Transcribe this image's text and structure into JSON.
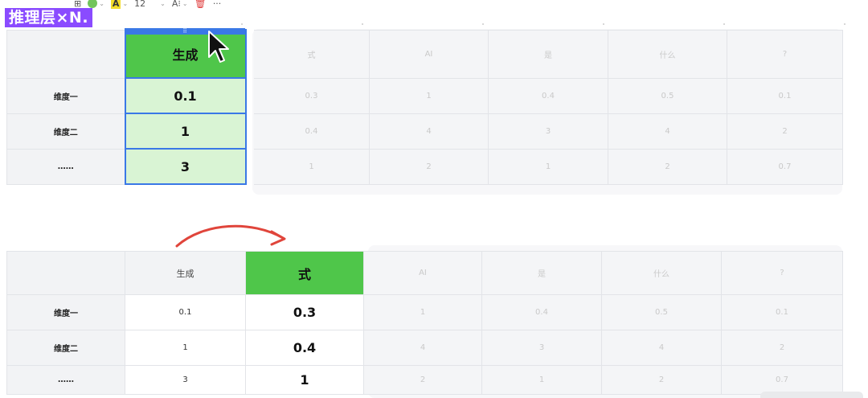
{
  "toolbar": {
    "layout_icon": "⊞",
    "font_size": "12",
    "text_style": "A⁝",
    "more": "···",
    "highlight_label": "A"
  },
  "title": "推理层×N.",
  "top_table": {
    "active_header": "生成",
    "faded_headers": [
      "式",
      "AI",
      "是",
      "什么",
      "?"
    ],
    "rows": [
      {
        "label": "维度一",
        "active": "0.1",
        "faded": [
          "0.3",
          "1",
          "0.4",
          "0.5",
          "0.1"
        ]
      },
      {
        "label": "维度二",
        "active": "1",
        "faded": [
          "0.4",
          "4",
          "3",
          "4",
          "2"
        ]
      },
      {
        "label": "……",
        "active": "3",
        "faded": [
          "1",
          "2",
          "1",
          "2",
          "0.7"
        ]
      }
    ]
  },
  "bottom_table": {
    "plain_header": "生成",
    "highlight_header": "式",
    "faded_headers": [
      "AI",
      "是",
      "什么",
      "?"
    ],
    "rows": [
      {
        "label": "维度一",
        "plain": "0.1",
        "highlight": "0.3",
        "faded": [
          "1",
          "0.4",
          "0.5",
          "0.1"
        ]
      },
      {
        "label": "维度二",
        "plain": "1",
        "highlight": "0.4",
        "faded": [
          "4",
          "3",
          "4",
          "2"
        ]
      },
      {
        "label": "……",
        "plain": "3",
        "highlight": "1",
        "faded": [
          "2",
          "1",
          "2",
          "0.7"
        ]
      }
    ]
  },
  "colors": {
    "active_green": "#4fc64a",
    "active_fill": "#d9f4d4",
    "selection_blue": "#3a78e6",
    "title_purple": "#8a4bff",
    "arrow_red": "#e0453b"
  }
}
